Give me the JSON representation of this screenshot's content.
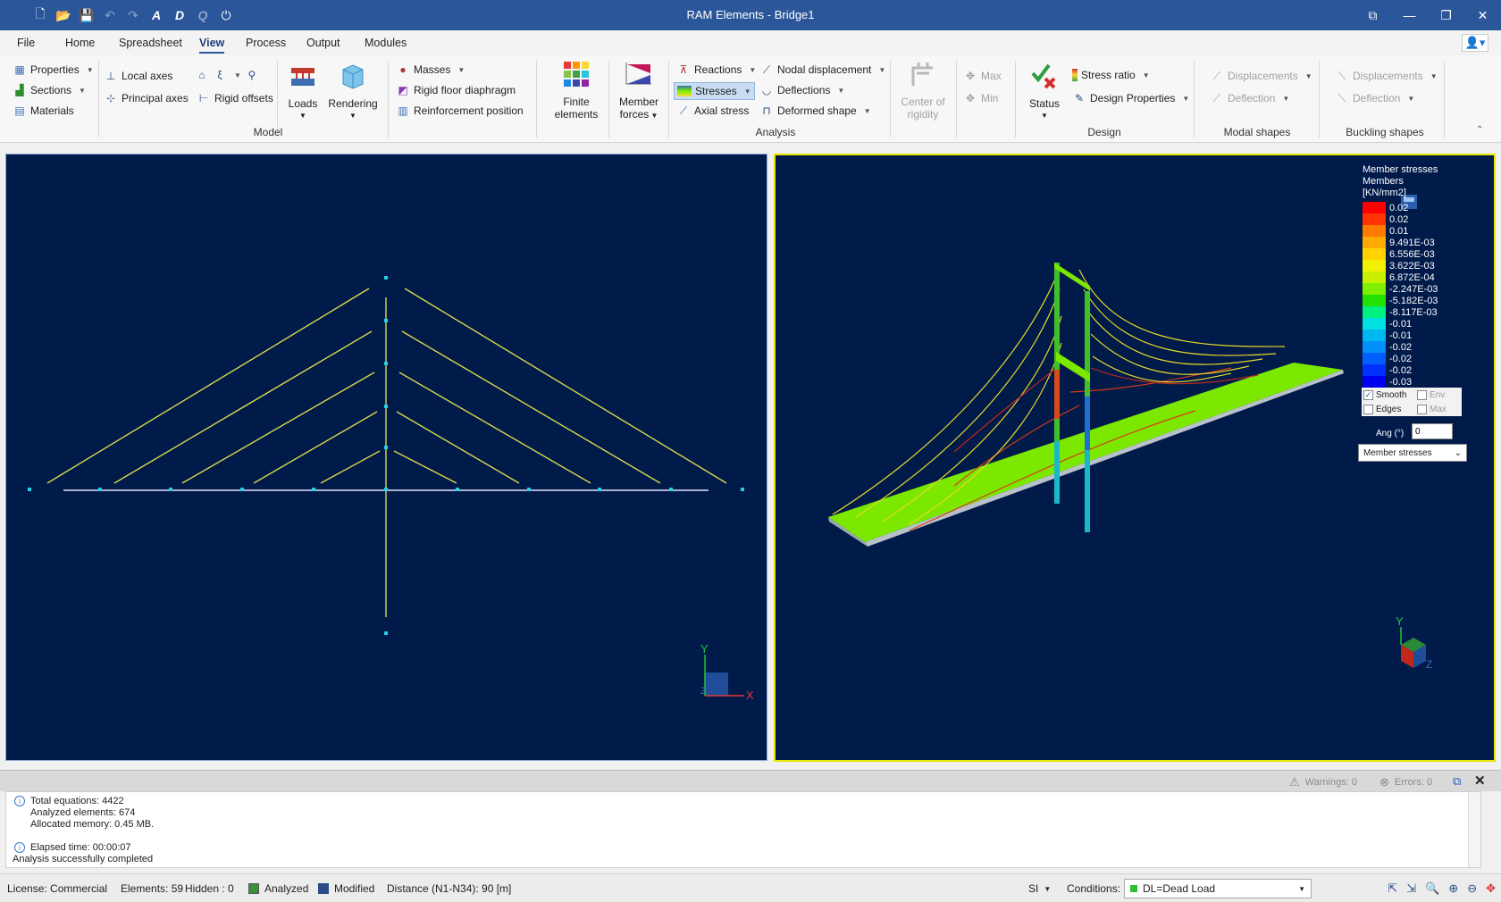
{
  "window": {
    "title": "RAM Elements - Bridge1",
    "quick_access": [
      "new-icon",
      "open-icon",
      "save-icon",
      "undo-icon",
      "redo-icon",
      "font-a-icon",
      "font-d-icon",
      "font-q-icon",
      "power-icon"
    ]
  },
  "tabs": [
    "File",
    "Home",
    "Spreadsheet",
    "View",
    "Process",
    "Output",
    "Modules"
  ],
  "active_tab": "View",
  "ribbon": {
    "model": {
      "group": "Model",
      "properties": "Properties",
      "sections": "Sections",
      "materials": "Materials",
      "local_axes": "Local axes",
      "principal_axes": "Principal axes",
      "rigid_offsets": "Rigid offsets",
      "loads": "Loads",
      "rendering": "Rendering",
      "masses": "Masses",
      "rigid_floor": "Rigid floor diaphragm",
      "reinforcement": "Reinforcement position"
    },
    "analysis": {
      "group": "Analysis",
      "finite_elements": [
        "Finite",
        "elements"
      ],
      "member_forces": [
        "Member",
        "forces"
      ],
      "reactions": "Reactions",
      "stresses": "Stresses",
      "axial_stress": "Axial stress",
      "nodal_displacement": "Nodal displacement",
      "deflections": "Deflections",
      "deformed_shape": "Deformed shape",
      "center_of_rigidity": [
        "Center of",
        "rigidity"
      ],
      "max": "Max",
      "min": "Min"
    },
    "design": {
      "group": "Design",
      "status": "Status",
      "stress_ratio": "Stress ratio",
      "design_properties": "Design Properties"
    },
    "modal_shapes": {
      "group": "Modal shapes",
      "displacements": "Displacements",
      "deflection": "Deflection"
    },
    "buckling_shapes": {
      "group": "Buckling shapes",
      "displacements": "Displacements",
      "deflection": "Deflection"
    }
  },
  "viewport_right": {
    "legend_title": [
      "Member stresses",
      "Members",
      "[KN/mm2]"
    ],
    "legend": [
      {
        "label": "0.02",
        "color": "#ff0000"
      },
      {
        "label": "0.02",
        "color": "#ff3300"
      },
      {
        "label": "0.01",
        "color": "#ff7a00"
      },
      {
        "label": "9.491E-03",
        "color": "#ffaa00"
      },
      {
        "label": "6.556E-03",
        "color": "#ffd200"
      },
      {
        "label": "3.622E-03",
        "color": "#f2f200"
      },
      {
        "label": "6.872E-04",
        "color": "#c8f000"
      },
      {
        "label": "-2.247E-03",
        "color": "#7cf000"
      },
      {
        "label": "-5.182E-03",
        "color": "#22e000"
      },
      {
        "label": "-8.117E-03",
        "color": "#00f080"
      },
      {
        "label": "-0.01",
        "color": "#00e0e0"
      },
      {
        "label": "-0.01",
        "color": "#00b8f0"
      },
      {
        "label": "-0.02",
        "color": "#0090f8"
      },
      {
        "label": "-0.02",
        "color": "#0060ff"
      },
      {
        "label": "-0.02",
        "color": "#0030ff"
      },
      {
        "label": "-0.03",
        "color": "#0000f0"
      }
    ],
    "smooth": "Smooth",
    "env": "Env",
    "edges": "Edges",
    "max": "Max",
    "angle_label": "Ang (°)",
    "angle_value": "0",
    "result_select": "Member stresses"
  },
  "axes": {
    "x": "X",
    "y": "Y",
    "z": "Z"
  },
  "output": {
    "warnings": "Warnings: 0",
    "errors": "Errors: 0",
    "lines": {
      "total_equations": "Total equations: 4422",
      "analyzed_elements": "Analyzed elements: 674",
      "allocated_memory": "Allocated memory: 0.45 MB.",
      "elapsed": "Elapsed time: 00:00:07",
      "success": "Analysis successfully completed"
    }
  },
  "status": {
    "license": "License: Commercial",
    "elements": "Elements: 59",
    "hidden": "Hidden : 0",
    "analyzed": "Analyzed",
    "modified": "Modified",
    "distance": "Distance (N1-N34): 90 [m]",
    "units": "SI",
    "conditions_label": "Conditions:",
    "condition": "DL=Dead Load",
    "condition_color": "#2fbf2f"
  }
}
